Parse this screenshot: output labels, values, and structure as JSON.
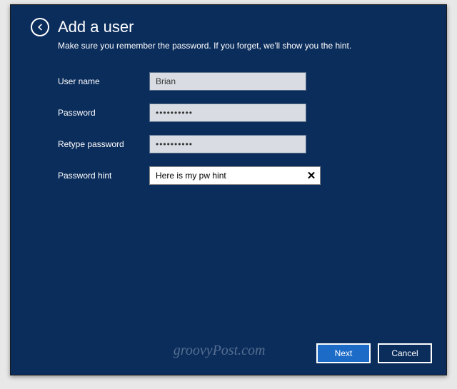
{
  "header": {
    "title": "Add a user",
    "subtitle": "Make sure you remember the password. If you forget, we'll show you the hint."
  },
  "form": {
    "username": {
      "label": "User name",
      "value": "Brian"
    },
    "password": {
      "label": "Password",
      "value": "••••••••••"
    },
    "retype": {
      "label": "Retype password",
      "value": "••••••••••"
    },
    "hint": {
      "label": "Password hint",
      "value": "Here is my pw hint"
    }
  },
  "footer": {
    "next": "Next",
    "cancel": "Cancel"
  },
  "watermark": "groovyPost.com"
}
